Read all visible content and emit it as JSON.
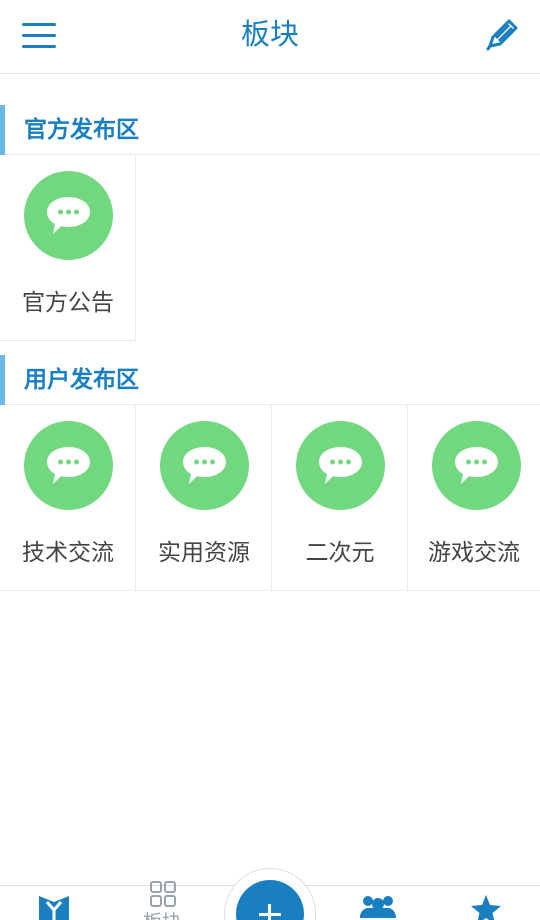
{
  "header": {
    "title": "板块",
    "menu_icon": "hamburger-menu-icon",
    "edit_icon": "pencil-edit-icon"
  },
  "sections": [
    {
      "title": "官方发布区",
      "items": [
        {
          "label": "官方公告",
          "icon": "chat-bubble-icon"
        }
      ]
    },
    {
      "title": "用户发布区",
      "items": [
        {
          "label": "技术交流",
          "icon": "chat-bubble-icon"
        },
        {
          "label": "实用资源",
          "icon": "chat-bubble-icon"
        },
        {
          "label": "二次元",
          "icon": "chat-bubble-icon"
        },
        {
          "label": "游戏交流",
          "icon": "chat-bubble-icon"
        }
      ]
    }
  ],
  "bottom_nav": {
    "items": [
      {
        "label": "",
        "icon": "home-logo-icon"
      },
      {
        "label": "板块",
        "icon": "grid-icon"
      },
      {
        "label": "",
        "icon": "add-icon"
      },
      {
        "label": "",
        "icon": "users-group-icon"
      },
      {
        "label": "",
        "icon": "star-icon"
      }
    ]
  },
  "colors": {
    "accent": "#1a7fc1",
    "section_bar": "#6bb8e6",
    "bubble_green": "#72d880",
    "divider": "#ececec"
  }
}
